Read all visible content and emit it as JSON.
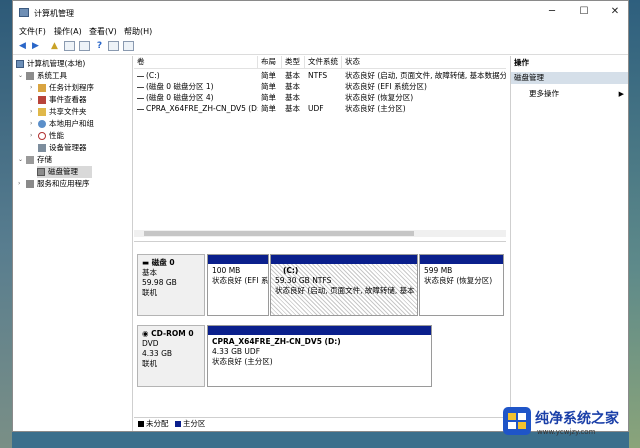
{
  "window": {
    "title": "计算机管理",
    "controls": [
      "─",
      "☐",
      "✕"
    ]
  },
  "menu": [
    "文件(F)",
    "操作(A)",
    "查看(V)",
    "帮助(H)"
  ],
  "tree": {
    "root": "计算机管理(本地)",
    "system_tools": "系统工具",
    "items": [
      "任务计划程序",
      "事件查看器",
      "共享文件夹",
      "本地用户和组",
      "性能",
      "设备管理器"
    ],
    "storage": "存储",
    "disk_mgmt": "磁盘管理",
    "services": "服务和应用程序"
  },
  "volumes": {
    "headers": [
      "卷",
      "布局",
      "类型",
      "文件系统",
      "状态"
    ],
    "rows": [
      {
        "name": "(C:)",
        "layout": "简单",
        "type": "基本",
        "fs": "NTFS",
        "status": "状态良好 (启动, 页面文件, 故障转储, 基本数据分"
      },
      {
        "name": "(磁盘 0 磁盘分区 1)",
        "layout": "简单",
        "type": "基本",
        "fs": "",
        "status": "状态良好 (EFI 系统分区)"
      },
      {
        "name": "(磁盘 0 磁盘分区 4)",
        "layout": "简单",
        "type": "基本",
        "fs": "",
        "status": "状态良好 (恢复分区)"
      },
      {
        "name": "CPRA_X64FRE_ZH-CN_DV5 (D:)",
        "layout": "简单",
        "type": "基本",
        "fs": "UDF",
        "status": "状态良好 (主分区)"
      }
    ]
  },
  "disks": [
    {
      "title": "磁盘 0",
      "kind": "基本",
      "size": "59.98 GB",
      "state": "联机",
      "partitions": [
        {
          "name": "",
          "size": "100 MB",
          "status": "状态良好 (EFI 系"
        },
        {
          "name": "(C:)",
          "size": "59.30 GB NTFS",
          "status": "状态良好 (启动, 页面文件, 故障转储, 基本"
        },
        {
          "name": "",
          "size": "599 MB",
          "status": "状态良好 (恢复分区)"
        }
      ]
    },
    {
      "title": "CD-ROM 0",
      "kind": "DVD",
      "size": "4.33 GB",
      "state": "联机",
      "partitions": [
        {
          "name": "CPRA_X64FRE_ZH-CN_DV5 (D:)",
          "size": "4.33 GB UDF",
          "status": "状态良好 (主分区)"
        }
      ]
    }
  ],
  "legend": [
    "未分配",
    "主分区"
  ],
  "legend_colors": [
    "#000000",
    "#0a1f8c"
  ],
  "actions": {
    "header": "操作",
    "section": "磁盘管理",
    "more": "更多操作"
  },
  "watermark": {
    "title": "纯净系统之家",
    "url": "www.ycwjzy.com"
  }
}
